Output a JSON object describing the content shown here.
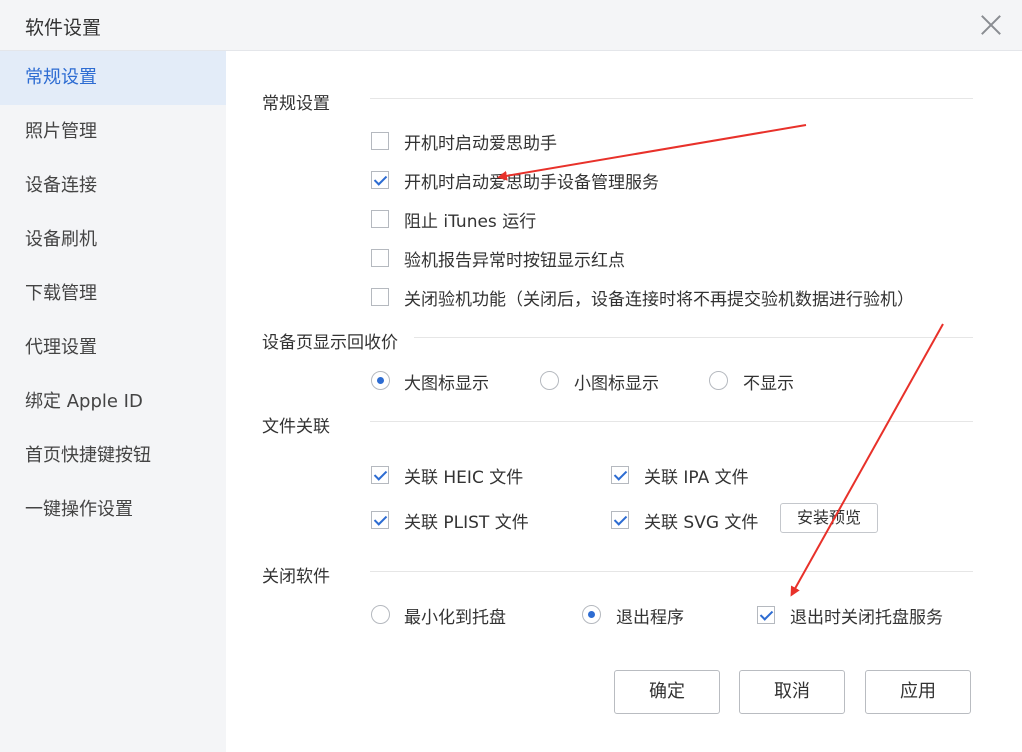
{
  "window": {
    "title": "软件设置"
  },
  "sidebar": {
    "items": [
      {
        "label": "常规设置"
      },
      {
        "label": "照片管理"
      },
      {
        "label": "设备连接"
      },
      {
        "label": "设备刷机"
      },
      {
        "label": "下载管理"
      },
      {
        "label": "代理设置"
      },
      {
        "label": "绑定 Apple ID"
      },
      {
        "label": "首页快捷键按钮"
      },
      {
        "label": "一键操作设置"
      }
    ],
    "active_index": 0
  },
  "general": {
    "title": "常规设置",
    "options": [
      {
        "label": "开机时启动爱思助手",
        "checked": false
      },
      {
        "label": "开机时启动爱思助手设备管理服务",
        "checked": true
      },
      {
        "label": "阻止 iTunes 运行",
        "checked": false
      },
      {
        "label": "验机报告异常时按钮显示红点",
        "checked": false
      },
      {
        "label": "关闭验机功能（关闭后，设备连接时将不再提交验机数据进行验机）",
        "checked": false
      }
    ]
  },
  "recycle_price": {
    "title": "设备页显示回收价",
    "options": [
      {
        "label": "大图标显示",
        "selected": true
      },
      {
        "label": "小图标显示",
        "selected": false
      },
      {
        "label": "不显示",
        "selected": false
      }
    ]
  },
  "file_assoc": {
    "title": "文件关联",
    "options": [
      {
        "label": "关联 HEIC 文件",
        "checked": true
      },
      {
        "label": "关联 IPA 文件",
        "checked": true
      },
      {
        "label": "关联 PLIST 文件",
        "checked": true
      },
      {
        "label": "关联 SVG 文件",
        "checked": true
      }
    ],
    "install_preview": "安装预览"
  },
  "close_app": {
    "title": "关闭软件",
    "options": [
      {
        "label": "最小化到托盘",
        "selected": false
      },
      {
        "label": "退出程序",
        "selected": true
      }
    ],
    "tray_option": {
      "label": "退出时关闭托盘服务",
      "checked": true
    }
  },
  "footer": {
    "ok": "确定",
    "cancel": "取消",
    "apply": "应用"
  },
  "colors": {
    "accent": "#2d6cd2",
    "annotation": "#e8312a"
  }
}
